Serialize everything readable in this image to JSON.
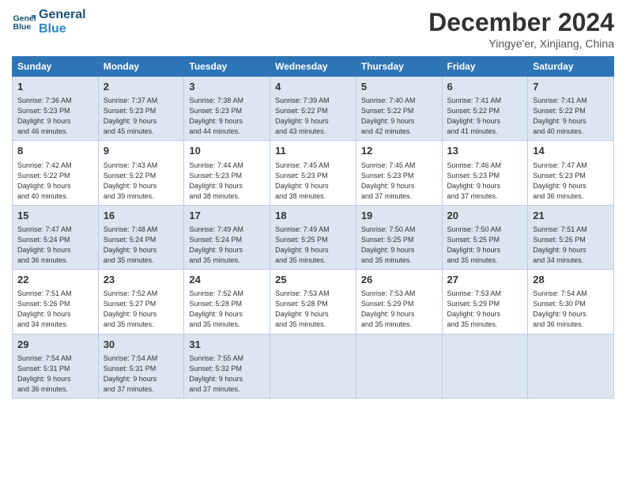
{
  "header": {
    "logo_line1": "General",
    "logo_line2": "Blue",
    "month": "December 2024",
    "location": "Yingye'er, Xinjiang, China"
  },
  "days_of_week": [
    "Sunday",
    "Monday",
    "Tuesday",
    "Wednesday",
    "Thursday",
    "Friday",
    "Saturday"
  ],
  "weeks": [
    [
      {
        "day": "1",
        "info": "Sunrise: 7:36 AM\nSunset: 5:23 PM\nDaylight: 9 hours\nand 46 minutes."
      },
      {
        "day": "2",
        "info": "Sunrise: 7:37 AM\nSunset: 5:23 PM\nDaylight: 9 hours\nand 45 minutes."
      },
      {
        "day": "3",
        "info": "Sunrise: 7:38 AM\nSunset: 5:23 PM\nDaylight: 9 hours\nand 44 minutes."
      },
      {
        "day": "4",
        "info": "Sunrise: 7:39 AM\nSunset: 5:22 PM\nDaylight: 9 hours\nand 43 minutes."
      },
      {
        "day": "5",
        "info": "Sunrise: 7:40 AM\nSunset: 5:22 PM\nDaylight: 9 hours\nand 42 minutes."
      },
      {
        "day": "6",
        "info": "Sunrise: 7:41 AM\nSunset: 5:22 PM\nDaylight: 9 hours\nand 41 minutes."
      },
      {
        "day": "7",
        "info": "Sunrise: 7:41 AM\nSunset: 5:22 PM\nDaylight: 9 hours\nand 40 minutes."
      }
    ],
    [
      {
        "day": "8",
        "info": "Sunrise: 7:42 AM\nSunset: 5:22 PM\nDaylight: 9 hours\nand 40 minutes."
      },
      {
        "day": "9",
        "info": "Sunrise: 7:43 AM\nSunset: 5:22 PM\nDaylight: 9 hours\nand 39 minutes."
      },
      {
        "day": "10",
        "info": "Sunrise: 7:44 AM\nSunset: 5:23 PM\nDaylight: 9 hours\nand 38 minutes."
      },
      {
        "day": "11",
        "info": "Sunrise: 7:45 AM\nSunset: 5:23 PM\nDaylight: 9 hours\nand 38 minutes."
      },
      {
        "day": "12",
        "info": "Sunrise: 7:45 AM\nSunset: 5:23 PM\nDaylight: 9 hours\nand 37 minutes."
      },
      {
        "day": "13",
        "info": "Sunrise: 7:46 AM\nSunset: 5:23 PM\nDaylight: 9 hours\nand 37 minutes."
      },
      {
        "day": "14",
        "info": "Sunrise: 7:47 AM\nSunset: 5:23 PM\nDaylight: 9 hours\nand 36 minutes."
      }
    ],
    [
      {
        "day": "15",
        "info": "Sunrise: 7:47 AM\nSunset: 5:24 PM\nDaylight: 9 hours\nand 36 minutes."
      },
      {
        "day": "16",
        "info": "Sunrise: 7:48 AM\nSunset: 5:24 PM\nDaylight: 9 hours\nand 35 minutes."
      },
      {
        "day": "17",
        "info": "Sunrise: 7:49 AM\nSunset: 5:24 PM\nDaylight: 9 hours\nand 35 minutes."
      },
      {
        "day": "18",
        "info": "Sunrise: 7:49 AM\nSunset: 5:25 PM\nDaylight: 9 hours\nand 35 minutes."
      },
      {
        "day": "19",
        "info": "Sunrise: 7:50 AM\nSunset: 5:25 PM\nDaylight: 9 hours\nand 35 minutes."
      },
      {
        "day": "20",
        "info": "Sunrise: 7:50 AM\nSunset: 5:25 PM\nDaylight: 9 hours\nand 35 minutes."
      },
      {
        "day": "21",
        "info": "Sunrise: 7:51 AM\nSunset: 5:26 PM\nDaylight: 9 hours\nand 34 minutes."
      }
    ],
    [
      {
        "day": "22",
        "info": "Sunrise: 7:51 AM\nSunset: 5:26 PM\nDaylight: 9 hours\nand 34 minutes."
      },
      {
        "day": "23",
        "info": "Sunrise: 7:52 AM\nSunset: 5:27 PM\nDaylight: 9 hours\nand 35 minutes."
      },
      {
        "day": "24",
        "info": "Sunrise: 7:52 AM\nSunset: 5:28 PM\nDaylight: 9 hours\nand 35 minutes."
      },
      {
        "day": "25",
        "info": "Sunrise: 7:53 AM\nSunset: 5:28 PM\nDaylight: 9 hours\nand 35 minutes."
      },
      {
        "day": "26",
        "info": "Sunrise: 7:53 AM\nSunset: 5:29 PM\nDaylight: 9 hours\nand 35 minutes."
      },
      {
        "day": "27",
        "info": "Sunrise: 7:53 AM\nSunset: 5:29 PM\nDaylight: 9 hours\nand 35 minutes."
      },
      {
        "day": "28",
        "info": "Sunrise: 7:54 AM\nSunset: 5:30 PM\nDaylight: 9 hours\nand 36 minutes."
      }
    ],
    [
      {
        "day": "29",
        "info": "Sunrise: 7:54 AM\nSunset: 5:31 PM\nDaylight: 9 hours\nand 36 minutes."
      },
      {
        "day": "30",
        "info": "Sunrise: 7:54 AM\nSunset: 5:31 PM\nDaylight: 9 hours\nand 37 minutes."
      },
      {
        "day": "31",
        "info": "Sunrise: 7:55 AM\nSunset: 5:32 PM\nDaylight: 9 hours\nand 37 minutes."
      },
      {
        "day": "",
        "info": ""
      },
      {
        "day": "",
        "info": ""
      },
      {
        "day": "",
        "info": ""
      },
      {
        "day": "",
        "info": ""
      }
    ]
  ]
}
